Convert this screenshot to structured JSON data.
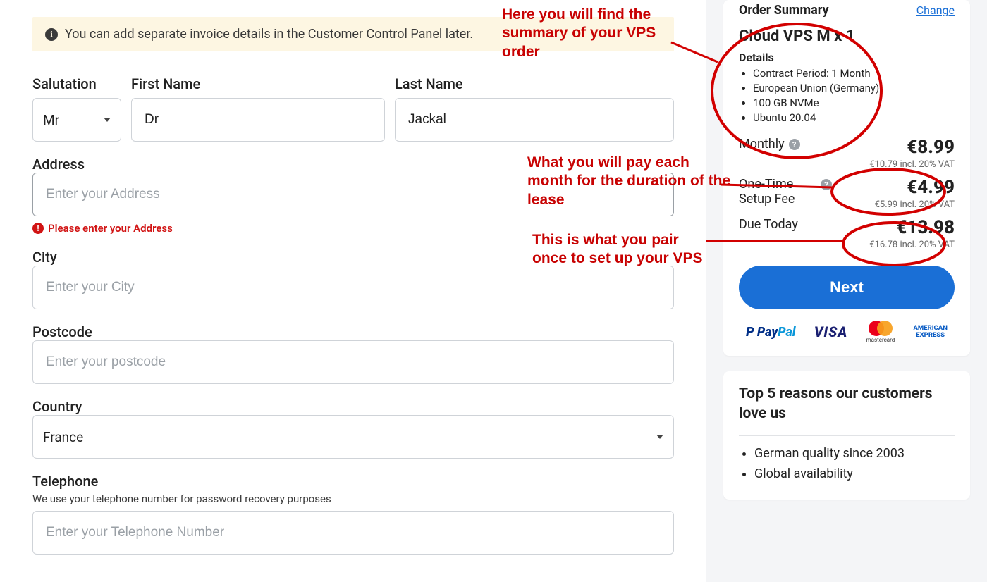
{
  "notice": {
    "text": "You can add separate invoice details in the Customer Control Panel later."
  },
  "form": {
    "salutation": {
      "label": "Salutation",
      "value": "Mr"
    },
    "firstName": {
      "label": "First Name",
      "value": "Dr"
    },
    "lastName": {
      "label": "Last Name",
      "value": "Jackal"
    },
    "address": {
      "label": "Address",
      "placeholder": "Enter your Address",
      "error": "Please enter your Address"
    },
    "city": {
      "label": "City",
      "placeholder": "Enter your City"
    },
    "postcode": {
      "label": "Postcode",
      "placeholder": "Enter your postcode"
    },
    "country": {
      "label": "Country",
      "value": "France"
    },
    "telephone": {
      "label": "Telephone",
      "helper": "We use your telephone number for password recovery purposes",
      "placeholder": "Enter your Telephone Number"
    }
  },
  "summary": {
    "heading": "Order Summary",
    "changeLabel": "Change",
    "productName": "Cloud VPS M x 1",
    "detailsLabel": "Details",
    "details": [
      "Contract Period: 1 Month",
      "European Union (Germany)",
      "100 GB NVMe",
      "Ubuntu 20.04"
    ],
    "monthly": {
      "label": "Monthly",
      "price": "€8.99",
      "sub": "€10.79 incl. 20% VAT"
    },
    "setup": {
      "label": "One-Time Setup Fee",
      "price": "€4.99",
      "sub": "€5.99 incl. 20% VAT"
    },
    "due": {
      "label": "Due Today",
      "price": "€13.98",
      "sub": "€16.78 incl. 20% VAT"
    },
    "nextLabel": "Next",
    "payment": {
      "paypal": "PayPal",
      "visa": "VISA",
      "mastercard": "mastercard",
      "amex1": "AMERICAN",
      "amex2": "EXPRESS"
    }
  },
  "reasons": {
    "title": "Top 5 reasons our customers love us",
    "items": [
      "German quality since 2003",
      "Global availability"
    ]
  },
  "annotations": {
    "a1": "Here you will find the summary of your VPS order",
    "a2": "What you will pay each month for the duration of the lease",
    "a3": "This is what you pair once to set up your VPS"
  }
}
